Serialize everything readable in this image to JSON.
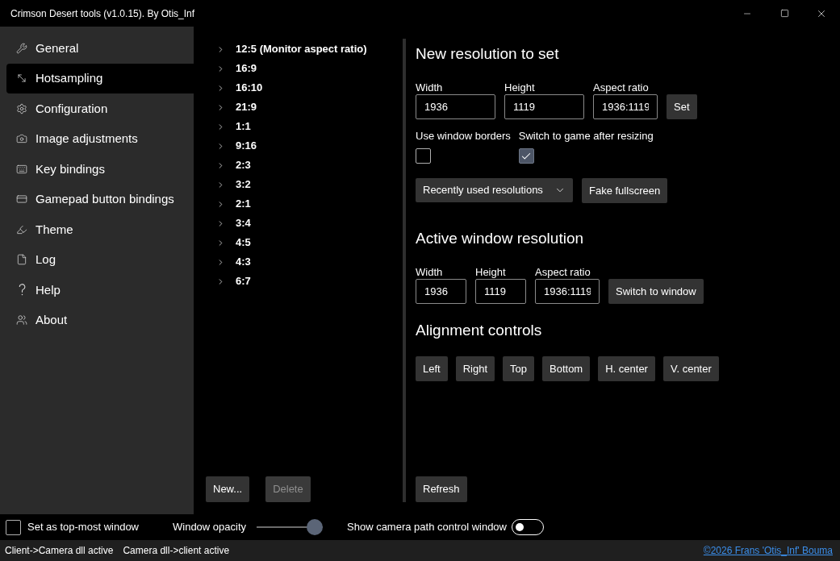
{
  "window": {
    "title": "Crimson Desert tools (v1.0.15). By Otis_Inf"
  },
  "sidebar": {
    "items": [
      {
        "label": "General",
        "selected": false
      },
      {
        "label": "Hotsampling",
        "selected": true
      },
      {
        "label": "Configuration",
        "selected": false
      },
      {
        "label": "Image adjustments",
        "selected": false
      },
      {
        "label": "Key bindings",
        "selected": false
      },
      {
        "label": "Gamepad button bindings",
        "selected": false
      },
      {
        "label": "Theme",
        "selected": false
      },
      {
        "label": "Log",
        "selected": false
      },
      {
        "label": "Help",
        "selected": false
      },
      {
        "label": "About",
        "selected": false
      }
    ]
  },
  "aspect_ratios": {
    "items": [
      {
        "label": "12:5 (Monitor aspect ratio)",
        "expanded": false
      },
      {
        "label": "16:9",
        "expanded": false
      },
      {
        "label": "16:10",
        "expanded": false
      },
      {
        "label": "21:9",
        "expanded": false
      },
      {
        "label": "1:1",
        "expanded": false
      },
      {
        "label": "9:16",
        "expanded": false
      },
      {
        "label": "2:3",
        "expanded": false
      },
      {
        "label": "3:2",
        "expanded": false
      },
      {
        "label": "2:1",
        "expanded": false
      },
      {
        "label": "3:4",
        "expanded": false
      },
      {
        "label": "4:5",
        "expanded": false
      },
      {
        "label": "4:3",
        "expanded": false
      },
      {
        "label": "6:7",
        "expanded": false
      }
    ],
    "buttons": [
      {
        "label": "New...",
        "disabled": false
      },
      {
        "label": "Delete",
        "disabled": true
      }
    ]
  },
  "new_resolution": {
    "title": "New resolution to set",
    "fields": [
      {
        "label": "Width",
        "value": "1936"
      },
      {
        "label": "Height",
        "value": "1119"
      },
      {
        "label": "Aspect ratio",
        "value": "1936:1119"
      }
    ],
    "set_button": "Set",
    "checkboxes": [
      {
        "label": "Use window borders",
        "checked": false
      },
      {
        "label": "Switch to game after resizing",
        "checked": true
      }
    ],
    "dropdown": {
      "label": "Recently used resolutions"
    },
    "fake_fullscreen_button": "Fake fullscreen"
  },
  "active_window_resolution": {
    "title": "Active window resolution",
    "fields": [
      {
        "label": "Width",
        "value": "1936"
      },
      {
        "label": "Height",
        "value": "1119"
      },
      {
        "label": "Aspect ratio",
        "value": "1936:1119"
      }
    ],
    "switch_button": "Switch to window"
  },
  "alignment_controls": {
    "title": "Alignment controls",
    "buttons": [
      "Left",
      "Right",
      "Top",
      "Bottom",
      "H. center",
      "V. center"
    ]
  },
  "refresh_button": "Refresh",
  "options_bar": {
    "topmost_checkbox": {
      "label": "Set as top-most window",
      "checked": false
    },
    "opacity_slider": {
      "label": "Window opacity",
      "level": 1
    },
    "camera_path_toggle": {
      "label": "Show camera path control window",
      "on": false
    }
  },
  "status_bar": {
    "items": [
      "Client->Camera dll active",
      "Camera dll->client active"
    ],
    "link": "©2026 Frans 'Otis_Inf' Bouma"
  }
}
